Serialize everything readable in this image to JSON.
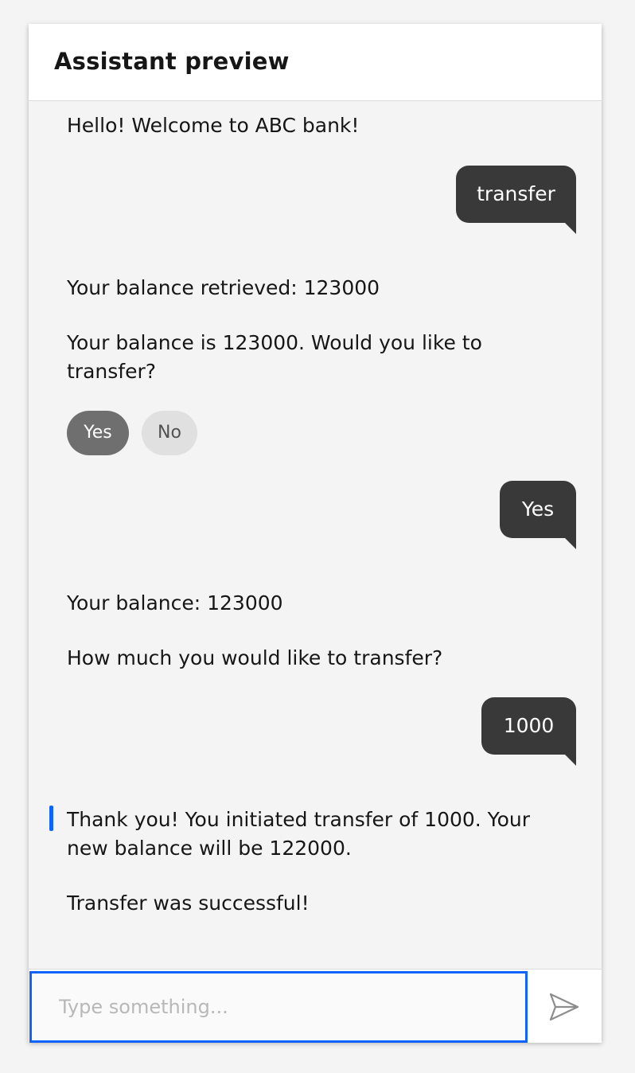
{
  "header": {
    "title": "Assistant preview"
  },
  "conversation": {
    "welcome": "Hello! Welcome to ABC bank!",
    "user_1": "transfer",
    "bot_1a": "Your balance retrieved: 123000",
    "bot_1b": "Your balance is 123000. Would you like to transfer?",
    "options": {
      "yes": "Yes",
      "no": "No"
    },
    "user_2": "Yes",
    "bot_2a": "Your balance: 123000",
    "bot_2b": "How much you would like to transfer?",
    "user_3": "1000",
    "bot_3a": "Thank you! You initiated transfer of 1000. Your new balance will be 122000.",
    "bot_3b": "Transfer was successful!"
  },
  "composer": {
    "placeholder": "Type something...",
    "value": ""
  },
  "icons": {
    "send": "send-icon"
  },
  "colors": {
    "accent": "#0f62fe",
    "user_bubble": "#393939",
    "chip_selected": "#6f6f6f",
    "chip_unselected": "#e0e0e0"
  }
}
